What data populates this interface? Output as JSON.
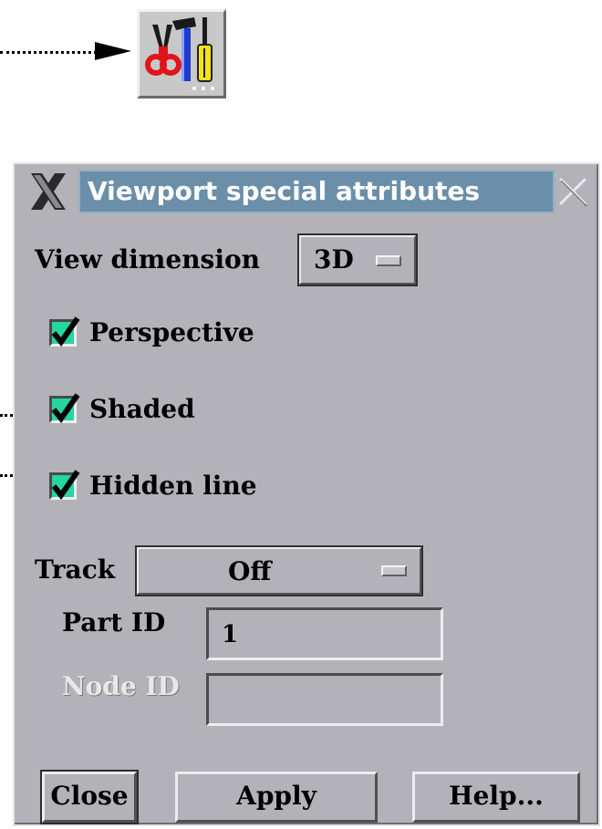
{
  "toolbar_icon": {
    "icon": "tools-icon"
  },
  "dialog": {
    "title": "Viewport special attributes",
    "view_dimension": {
      "label": "View dimension",
      "value": "3D"
    },
    "checkboxes": [
      {
        "label": "Perspective",
        "checked": true
      },
      {
        "label": "Shaded",
        "checked": true
      },
      {
        "label": "Hidden line",
        "checked": true
      }
    ],
    "track": {
      "label": "Track",
      "value": "Off"
    },
    "part_id": {
      "label": "Part ID",
      "value": "1"
    },
    "node_id": {
      "label": "Node ID",
      "value": ""
    },
    "buttons": {
      "close": "Close",
      "apply": "Apply",
      "help": "Help..."
    }
  },
  "colors": {
    "dialog_bg": "#b3b2b8",
    "title_bg": "#6b8fa8",
    "check_fill": "#25d6a0"
  }
}
